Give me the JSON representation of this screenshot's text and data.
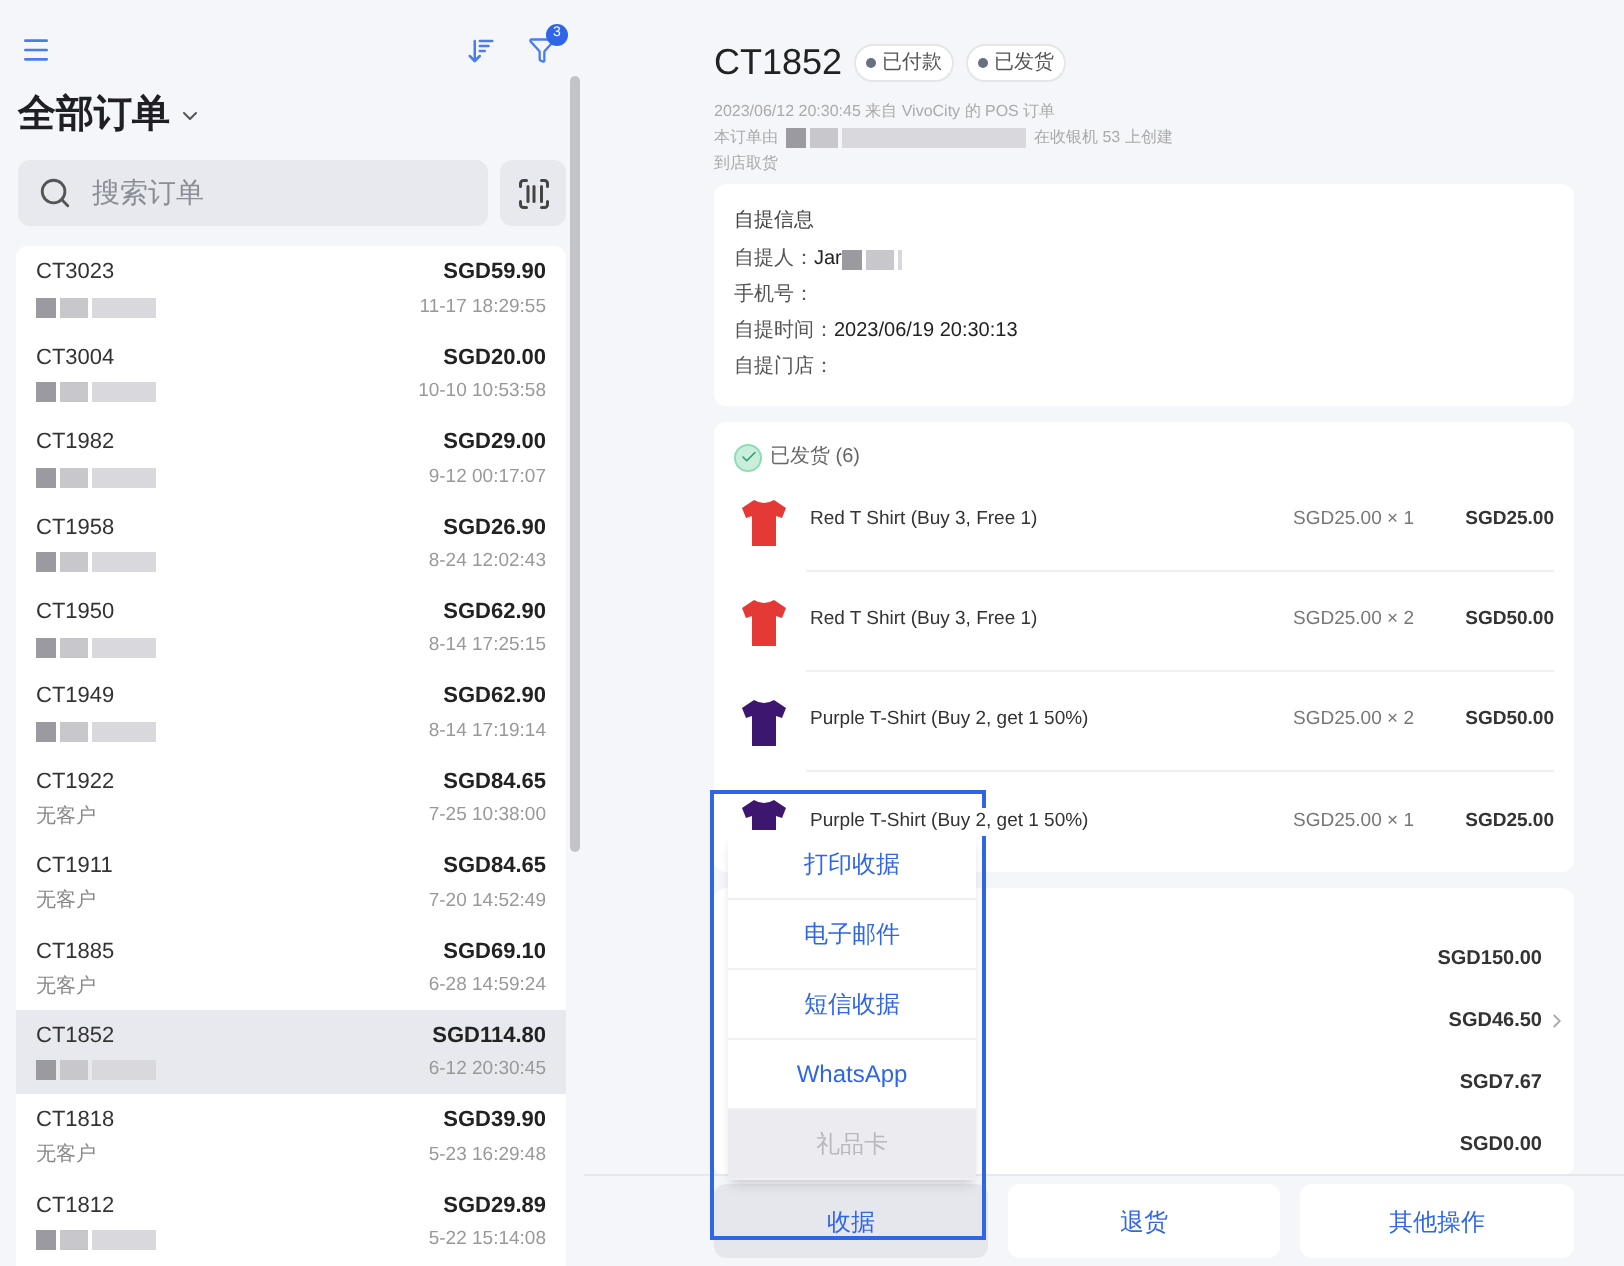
{
  "sidebar": {
    "title": "全部订单",
    "filter_count": "3",
    "search": {
      "placeholder": "搜索订单"
    },
    "orders": [
      {
        "number": "CT3023",
        "total": "SGD59.90",
        "time": "11-17 18:29:55",
        "redacted": true,
        "selected": false
      },
      {
        "number": "CT3004",
        "total": "SGD20.00",
        "time": "10-10 10:53:58",
        "redacted": true,
        "selected": false
      },
      {
        "number": "CT1982",
        "total": "SGD29.00",
        "time": "9-12 00:17:07",
        "redacted": true,
        "selected": false
      },
      {
        "number": "CT1958",
        "total": "SGD26.90",
        "time": "8-24 12:02:43",
        "redacted": true,
        "selected": false
      },
      {
        "number": "CT1950",
        "total": "SGD62.90",
        "time": "8-14 17:25:15",
        "redacted": true,
        "selected": false
      },
      {
        "number": "CT1949",
        "total": "SGD62.90",
        "time": "8-14 17:19:14",
        "redacted": true,
        "selected": false
      },
      {
        "number": "CT1922",
        "total": "SGD84.65",
        "time": "7-25 10:38:00",
        "customer": "无客户",
        "selected": false
      },
      {
        "number": "CT1911",
        "total": "SGD84.65",
        "time": "7-20 14:52:49",
        "customer": "无客户",
        "selected": false
      },
      {
        "number": "CT1885",
        "total": "SGD69.10",
        "time": "6-28 14:59:24",
        "customer": "无客户",
        "selected": false
      },
      {
        "number": "CT1852",
        "total": "SGD114.80",
        "time": "6-12 20:30:45",
        "redacted": true,
        "selected": true
      },
      {
        "number": "CT1818",
        "total": "SGD39.90",
        "time": "5-23 16:29:48",
        "customer": "无客户",
        "selected": false
      },
      {
        "number": "CT1812",
        "total": "SGD29.89",
        "time": "5-22 15:14:08",
        "redacted": true,
        "selected": false
      }
    ]
  },
  "order": {
    "number": "CT1852",
    "badges": [
      "已付款",
      "已发货"
    ],
    "meta": [
      "2023/06/12 20:30:45 来自 VivoCity 的 POS 订单"
    ],
    "creator_prefix": "本订单由",
    "creator_suffix": "在收银机 53 上创建",
    "delivery": "到店取货",
    "pickup": {
      "title": "自提信息",
      "fields": [
        {
          "label": "自提人：",
          "value": "Jar",
          "redacted": true
        },
        {
          "label": "手机号："
        },
        {
          "label": "自提时间：",
          "value": "2023/06/19 20:30:13"
        },
        {
          "label": "自提门店："
        }
      ]
    },
    "fulfillment": {
      "status": "已发货 (6)",
      "items": [
        {
          "name": "Red T Shirt (Buy 3, Free 1)",
          "unit": "SGD25.00 × 1",
          "total": "SGD25.00",
          "color": "#e53935"
        },
        {
          "name": "Red T Shirt (Buy 3, Free 1)",
          "unit": "SGD25.00 × 2",
          "total": "SGD50.00",
          "color": "#e53935"
        },
        {
          "name": "Purple T-Shirt (Buy 2, get 1 50%)",
          "unit": "SGD25.00 × 2",
          "total": "SGD50.00",
          "color": "#3d1670"
        },
        {
          "name": "Purple T-Shirt (Buy 2, get 1 50%)",
          "unit": "SGD25.00 × 1",
          "total": "SGD25.00",
          "color": "#3d1670"
        }
      ]
    },
    "totals": [
      {
        "value": "SGD150.00",
        "expandable": false
      },
      {
        "value": "SGD46.50",
        "expandable": true
      },
      {
        "value": "SGD7.67",
        "expandable": false
      },
      {
        "value": "SGD0.00",
        "expandable": false
      }
    ]
  },
  "receipt_menu": {
    "highlighted": true,
    "items": [
      {
        "label": "打印收据",
        "disabled": false
      },
      {
        "label": "电子邮件",
        "disabled": false
      },
      {
        "label": "短信收据",
        "disabled": false
      },
      {
        "label": "WhatsApp",
        "disabled": false
      },
      {
        "label": "礼品卡",
        "disabled": true
      }
    ]
  },
  "actions": [
    "收据",
    "退货",
    "其他操作"
  ]
}
